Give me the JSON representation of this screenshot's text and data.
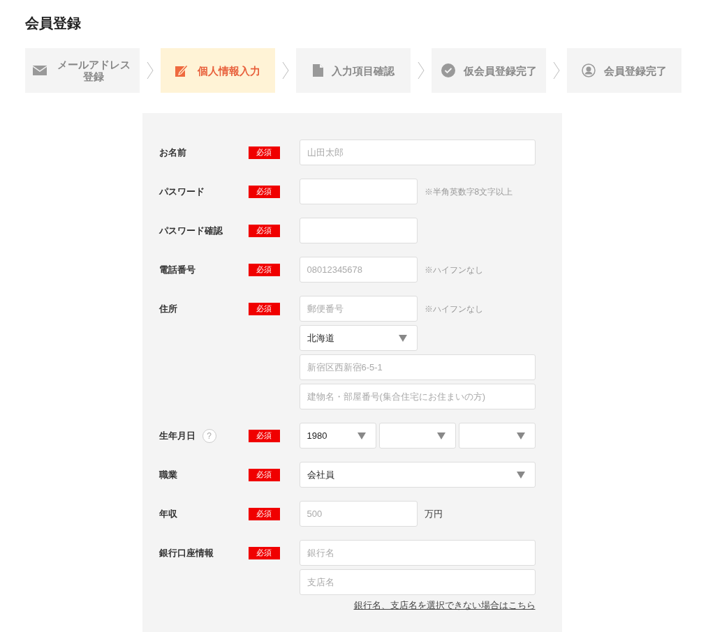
{
  "title": "会員登録",
  "steps": [
    {
      "label": "メールアドレス登録",
      "kind": "mail",
      "selected": false
    },
    {
      "label": "個人情報入力",
      "kind": "edit",
      "selected": true
    },
    {
      "label": "入力項目確認",
      "kind": "document",
      "selected": false
    },
    {
      "label": "仮会員登録完了",
      "kind": "check",
      "selected": false
    },
    {
      "label": "会員登録完了",
      "kind": "user",
      "selected": false
    }
  ],
  "form": {
    "rows": [
      {
        "label": "お名前",
        "badge": "必須",
        "lines": [
          {
            "fields": [
              {
                "kind": "wideinput",
                "placeholder": "山田太郎"
              }
            ]
          }
        ]
      },
      {
        "label": "パスワード",
        "badge": "必須",
        "lines": [
          {
            "fields": [
              {
                "kind": "shortinput"
              }
            ],
            "note": "※半角英数字8文字以上"
          }
        ]
      },
      {
        "label": "パスワード確認",
        "badge": "必須",
        "lines": [
          {
            "fields": [
              {
                "kind": "shortinput"
              }
            ]
          }
        ]
      },
      {
        "label": "電話番号",
        "badge": "必須",
        "lines": [
          {
            "fields": [
              {
                "kind": "shortinput",
                "placeholder": "08012345678"
              }
            ],
            "note": "※ハイフンなし"
          }
        ]
      },
      {
        "label": "住所",
        "badge": "必須",
        "lines": [
          {
            "fields": [
              {
                "kind": "shortinput",
                "placeholder": "郵便番号"
              }
            ],
            "note": "※ハイフンなし"
          },
          {
            "fields": [
              {
                "kind": "shortselect",
                "value": "北海道"
              }
            ]
          },
          {
            "fields": [
              {
                "kind": "wideinput",
                "placeholder": "新宿区西新宿6-5-1"
              }
            ]
          },
          {
            "fields": [
              {
                "kind": "wideinput",
                "placeholder": "建物名・部屋番号(集合住宅にお住まいの方)"
              }
            ]
          }
        ]
      },
      {
        "label": "生年月日",
        "help": "?",
        "badge": "必須",
        "lines": [
          {
            "fields": [
              {
                "kind": "smallselect",
                "value": "1980"
              },
              {
                "kind": "smallselect"
              },
              {
                "kind": "smallselect"
              }
            ]
          }
        ]
      },
      {
        "label": "職業",
        "badge": "必須",
        "lines": [
          {
            "fields": [
              {
                "kind": "wideselect",
                "value": "会社員"
              }
            ]
          }
        ]
      },
      {
        "label": "年収",
        "badge": "必須",
        "lines": [
          {
            "fields": [
              {
                "kind": "shortinput",
                "placeholder": "500"
              }
            ],
            "unit": "万円"
          }
        ]
      },
      {
        "label": "銀行口座情報",
        "badge": "必須",
        "lines": [
          {
            "fields": [
              {
                "kind": "wideinput",
                "placeholder": "銀行名"
              }
            ]
          },
          {
            "fields": [
              {
                "kind": "wideinput",
                "placeholder": "支店名"
              }
            ]
          }
        ]
      }
    ],
    "link": "銀行名、支店名を選択できない場合はこちら"
  }
}
